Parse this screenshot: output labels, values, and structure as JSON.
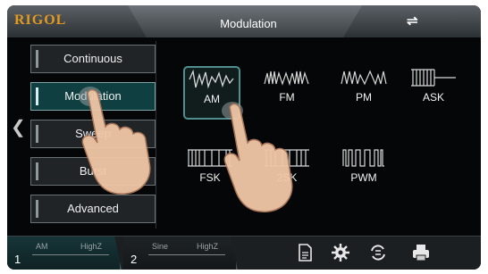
{
  "app": {
    "logo": "RIGOL",
    "title": "Modulation",
    "usb_icon": "usb-icon"
  },
  "sidebar": {
    "items": [
      {
        "label": "Continuous",
        "active": false
      },
      {
        "label": "Modulation",
        "active": true
      },
      {
        "label": "Sweep",
        "active": false
      },
      {
        "label": "Burst",
        "active": false
      },
      {
        "label": "Advanced",
        "active": false
      }
    ]
  },
  "modulation_types": [
    {
      "label": "AM",
      "active": true
    },
    {
      "label": "FM",
      "active": false
    },
    {
      "label": "PM",
      "active": false
    },
    {
      "label": "ASK",
      "active": false
    },
    {
      "label": "FSK",
      "active": false
    },
    {
      "label": "2SK",
      "active": false
    },
    {
      "label": "PWM",
      "active": false
    }
  ],
  "channels": [
    {
      "number": "1",
      "wave": "AM",
      "load": "HighZ"
    },
    {
      "number": "2",
      "wave": "Sine",
      "load": "HighZ"
    }
  ],
  "toolbar": {
    "icons": [
      "document-icon",
      "gear-icon",
      "sync-icon",
      "printer-icon"
    ]
  },
  "colors": {
    "accent": "#e39a1e",
    "active_teal": "#0f3f40",
    "background": "#050607"
  }
}
